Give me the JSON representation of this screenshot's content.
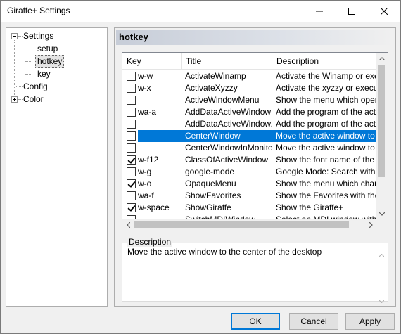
{
  "window": {
    "title": "Giraffe+ Settings"
  },
  "tree": {
    "items": [
      {
        "label": "Settings"
      },
      {
        "label": "setup"
      },
      {
        "label": "hotkey"
      },
      {
        "label": "key"
      },
      {
        "label": "Config"
      },
      {
        "label": "Color"
      }
    ]
  },
  "panel": {
    "heading": "hotkey"
  },
  "hotkey_list": {
    "columns": {
      "key": "Key",
      "title": "Title",
      "description": "Description"
    },
    "rows": [
      {
        "checked": false,
        "key": "w-w",
        "title": "ActivateWinamp",
        "description": "Activate the Winamp or exec"
      },
      {
        "checked": false,
        "key": "w-x",
        "title": "ActivateXyzzy",
        "description": "Activate the xyzzy or execut"
      },
      {
        "checked": false,
        "key": "",
        "title": "ActiveWindowMenu",
        "description": "Show the menu which operat"
      },
      {
        "checked": false,
        "key": "wa-a",
        "title": "AddDataActiveWindow",
        "description": "Add the program of the activ"
      },
      {
        "checked": false,
        "key": "",
        "title": "AddDataActiveWindow2",
        "description": "Add the program of the activ"
      },
      {
        "checked": false,
        "key": "",
        "title": "CenterWindow",
        "description": "Move the active window to th",
        "selected": true
      },
      {
        "checked": false,
        "key": "",
        "title": "CenterWindowInMonitor",
        "description": "Move the active window to th"
      },
      {
        "checked": true,
        "key": "w-f12",
        "title": "ClassOfActiveWindow",
        "description": "Show the font name of the fo"
      },
      {
        "checked": false,
        "key": "w-g",
        "title": "google-mode",
        "description": "Google Mode: Search with Go"
      },
      {
        "checked": true,
        "key": "w-o",
        "title": "OpaqueMenu",
        "description": "Show the menu which change"
      },
      {
        "checked": false,
        "key": "wa-f",
        "title": "ShowFavorites",
        "description": "Show the Favorites with the G"
      },
      {
        "checked": true,
        "key": "w-space",
        "title": "ShowGiraffe",
        "description": "Show the Giraffe+"
      },
      {
        "checked": false,
        "key": "",
        "title": "SwitchMDIWindow",
        "description": "Select an MDI window with the"
      }
    ]
  },
  "description": {
    "label": "Description",
    "text": "Move the active window to the center of the desktop"
  },
  "buttons": {
    "ok": "OK",
    "cancel": "Cancel",
    "apply": "Apply"
  }
}
